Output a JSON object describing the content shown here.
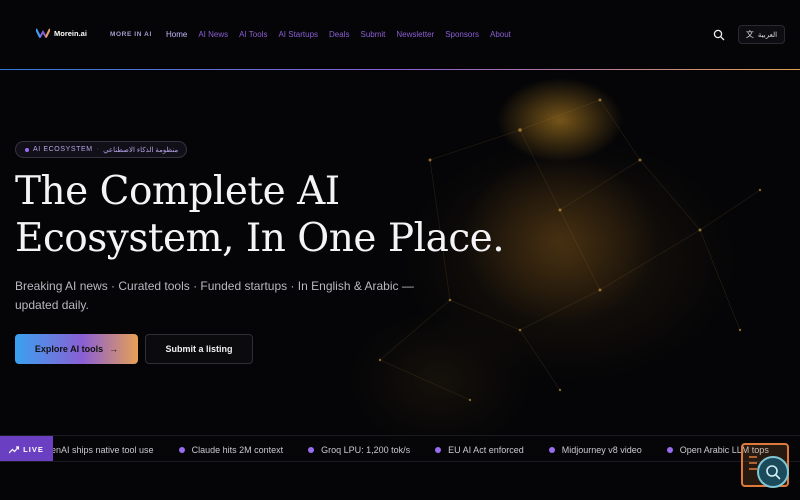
{
  "header": {
    "logo_text": "Morein.ai",
    "more_in_label": "MORE IN AI",
    "nav": [
      {
        "label": "Home",
        "active": true
      },
      {
        "label": "AI News"
      },
      {
        "label": "AI Tools"
      },
      {
        "label": "AI Startups"
      },
      {
        "label": "Deals"
      },
      {
        "label": "Submit"
      },
      {
        "label": "Newsletter"
      },
      {
        "label": "Sponsors"
      },
      {
        "label": "About"
      }
    ],
    "search_icon": "search-icon",
    "language_button": "العربية",
    "language_icon": "translate-icon"
  },
  "hero": {
    "badge_en": "AI ECOSYSTEM",
    "badge_sep": "·",
    "badge_ar": "منظومة الذكاء الاصطناعي",
    "title_line1": "The Complete AI",
    "title_line2": "Ecosystem, In One Place.",
    "subtitle": "Breaking AI news · Curated tools · Funded startups · In English & Arabic — updated daily.",
    "primary_cta": "Explore AI tools",
    "secondary_cta": "Submit a listing"
  },
  "ticker": {
    "live_label": "LIVE",
    "items": [
      "enAI ships native tool use",
      "Claude hits 2M context",
      "Groq LPU: 1,200 tok/s",
      "EU AI Act enforced",
      "Midjourney v8 video",
      "Open Arabic LLM tops"
    ]
  },
  "colors": {
    "accent_purple": "#8a5fd4",
    "gradient_blue": "#3aa1f0",
    "gradient_orange": "#e6a055",
    "background": "#050507"
  }
}
